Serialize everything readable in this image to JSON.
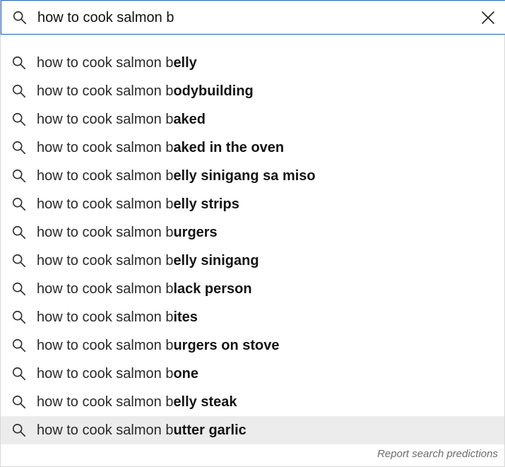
{
  "search": {
    "query": "how to cook salmon b",
    "icon": "search-icon",
    "clear_icon": "close-icon",
    "border_color": "#1c62b9"
  },
  "suggestions": [
    {
      "typed": "how to cook salmon b",
      "completion": "elly"
    },
    {
      "typed": "how to cook salmon b",
      "completion": "odybuilding"
    },
    {
      "typed": "how to cook salmon b",
      "completion": "aked"
    },
    {
      "typed": "how to cook salmon b",
      "completion": "aked in the oven"
    },
    {
      "typed": "how to cook salmon b",
      "completion": "elly sinigang sa miso"
    },
    {
      "typed": "how to cook salmon b",
      "completion": "elly strips"
    },
    {
      "typed": "how to cook salmon b",
      "completion": "urgers"
    },
    {
      "typed": "how to cook salmon b",
      "completion": "elly sinigang"
    },
    {
      "typed": "how to cook salmon b",
      "completion": "lack person"
    },
    {
      "typed": "how to cook salmon b",
      "completion": "ites"
    },
    {
      "typed": "how to cook salmon b",
      "completion": "urgers on stove"
    },
    {
      "typed": "how to cook salmon b",
      "completion": "one"
    },
    {
      "typed": "how to cook salmon b",
      "completion": "elly steak"
    },
    {
      "typed": "how to cook salmon b",
      "completion": "utter garlic",
      "highlighted": true
    }
  ],
  "footer": {
    "report_label": "Report search predictions"
  },
  "colors": {
    "highlight_bg": "#ececec",
    "report_text": "#6b6b6b"
  }
}
